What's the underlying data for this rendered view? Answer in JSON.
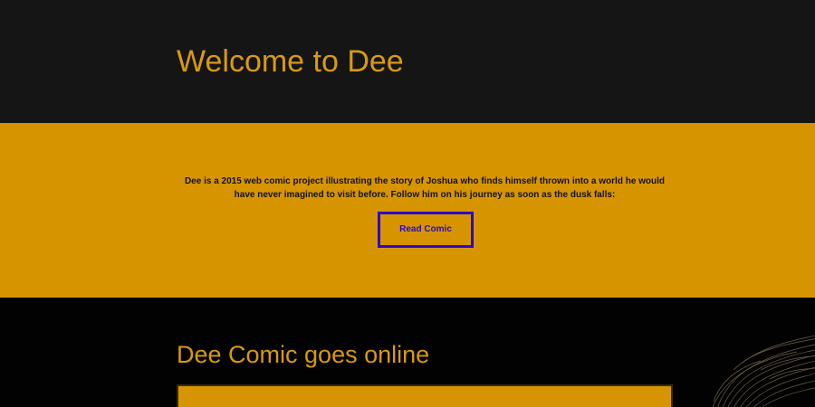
{
  "header": {
    "title": "Welcome to Dee"
  },
  "intro": {
    "description": "Dee is a 2015 web comic project illustrating the story of Joshua who finds himself thrown into a world he would have never imagined to visit before. Follow him on his journey as soon as the dusk falls:",
    "read_button_label": "Read Comic"
  },
  "news": {
    "heading": "Dee Comic goes online",
    "card_text": ""
  },
  "colors": {
    "accent": "#d69500",
    "header_bg": "#151515",
    "button_border": "#2a08c8"
  },
  "icons": {
    "decor": "sketch-hair-illustration"
  }
}
